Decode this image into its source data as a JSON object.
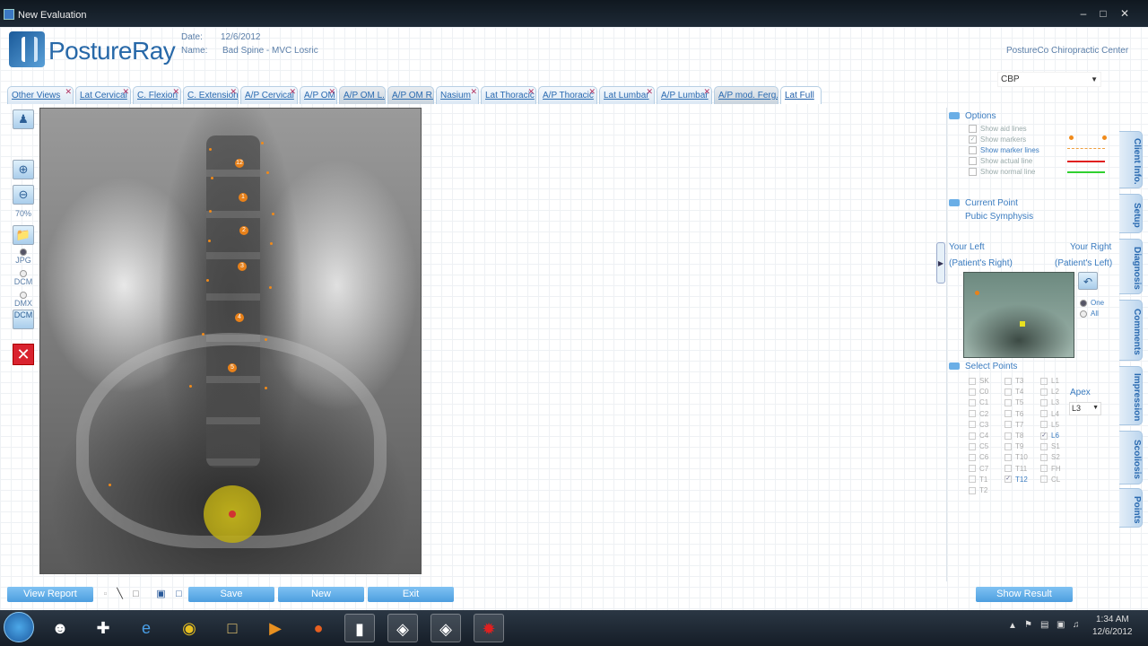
{
  "window": {
    "title": "New Evaluation",
    "minimize": "–",
    "maximize": "□",
    "close": "✕"
  },
  "header": {
    "brand": "PostureRay",
    "date_label": "Date:",
    "date_value": "12/6/2012",
    "name_label": "Name:",
    "name_value": "Bad Spine - MVC Losric",
    "clinic": "PostureCo Chiropractic Center",
    "cbp_value": "CBP"
  },
  "tabs": [
    {
      "label": "Other Views"
    },
    {
      "label": "Lat Cervical"
    },
    {
      "label": "C. Flexion"
    },
    {
      "label": "C. Extension"
    },
    {
      "label": "A/P Cervical"
    },
    {
      "label": "A/P OM"
    },
    {
      "label": "A/P OM L."
    },
    {
      "label": "A/P OM R."
    },
    {
      "label": "Nasium"
    },
    {
      "label": "Lat Thoracic"
    },
    {
      "label": "A/P Thoracic"
    },
    {
      "label": "Lat Lumbar"
    },
    {
      "label": "A/P Lumbar"
    },
    {
      "label": "A/P mod. Ferg."
    },
    {
      "label": "Lat Full"
    }
  ],
  "left_toolbar": {
    "zoom_value": "70%",
    "jpg_label": "JPG",
    "dcm_label": "DCM",
    "dmx_label": "DMX",
    "dcm_btn_label": "DCM"
  },
  "xray_markers": [
    "12",
    "1",
    "2",
    "3",
    "4",
    "5"
  ],
  "options": {
    "title": "Options",
    "items": [
      {
        "label": "Show aid lines",
        "checked": false
      },
      {
        "label": "Show markers",
        "checked": true
      },
      {
        "label": "Show marker lines",
        "checked": false
      },
      {
        "label": "Show actual line",
        "checked": false
      },
      {
        "label": "Show normal line",
        "checked": false
      }
    ]
  },
  "current_point": {
    "title": "Current Point",
    "value": "Pubic Symphysis"
  },
  "orientation": {
    "your_left": "Your Left",
    "your_right": "Your Right",
    "patients_right": "(Patient's Right)",
    "patients_left": "(Patient's Left)",
    "one_label": "One",
    "all_label": "All"
  },
  "select_points": {
    "title": "Select Points",
    "apex_label": "Apex",
    "apex_value": "L3",
    "col1": [
      {
        "label": "SK",
        "on": false
      },
      {
        "label": "C0",
        "on": false
      },
      {
        "label": "C1",
        "on": false
      },
      {
        "label": "C2",
        "on": false
      },
      {
        "label": "C3",
        "on": false
      },
      {
        "label": "C4",
        "on": false
      },
      {
        "label": "C5",
        "on": false
      },
      {
        "label": "C6",
        "on": false
      },
      {
        "label": "C7",
        "on": false
      },
      {
        "label": "T1",
        "on": false
      },
      {
        "label": "T2",
        "on": false
      }
    ],
    "col2": [
      {
        "label": "T3",
        "on": false
      },
      {
        "label": "T4",
        "on": false
      },
      {
        "label": "T5",
        "on": false
      },
      {
        "label": "T6",
        "on": false
      },
      {
        "label": "T7",
        "on": false
      },
      {
        "label": "T8",
        "on": false
      },
      {
        "label": "T9",
        "on": false
      },
      {
        "label": "T10",
        "on": false
      },
      {
        "label": "T11",
        "on": false
      },
      {
        "label": "T12",
        "on": true
      }
    ],
    "col3": [
      {
        "label": "L1",
        "on": false
      },
      {
        "label": "L2",
        "on": false
      },
      {
        "label": "L3",
        "on": false
      },
      {
        "label": "L4",
        "on": false
      },
      {
        "label": "L5",
        "on": false
      },
      {
        "label": "L6",
        "on": true
      },
      {
        "label": "S1",
        "on": false
      },
      {
        "label": "S2",
        "on": false
      },
      {
        "label": "FH",
        "on": false
      },
      {
        "label": "CL",
        "on": false
      }
    ]
  },
  "side_tabs": [
    "Client Info.",
    "Setup",
    "Diagnosis",
    "Comments",
    "Impression",
    "Scoliosis",
    "Points"
  ],
  "bottom": {
    "view_report": "View Report",
    "save": "Save",
    "new": "New",
    "exit": "Exit",
    "show_result": "Show Result"
  },
  "taskbar": {
    "time": "1:34 AM",
    "date": "12/6/2012"
  },
  "colors": {
    "accent": "#4c9edf",
    "tab_text": "#2a6ab0",
    "marker": "#e8811a"
  }
}
